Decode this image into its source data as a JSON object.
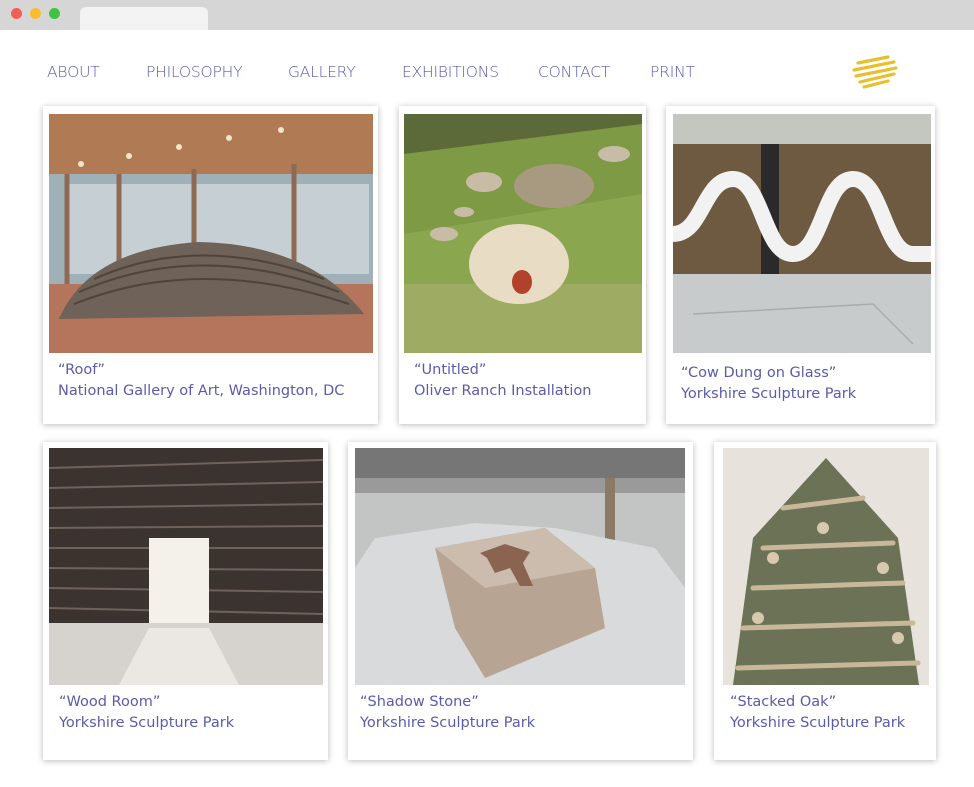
{
  "nav": {
    "items": [
      {
        "label": "ABOUT"
      },
      {
        "label": "PHILOSOPHY"
      },
      {
        "label": "GALLERY"
      },
      {
        "label": "EXHIBITIONS"
      },
      {
        "label": "CONTACT"
      },
      {
        "label": "PRINT"
      }
    ]
  },
  "colors": {
    "accent": "#5a5bab",
    "logo": "#e8c02c"
  },
  "gallery": {
    "cards": [
      {
        "title": "“Roof”",
        "location": "National Gallery of Art, Washington, DC"
      },
      {
        "title": "“Untitled”",
        "location": "Oliver Ranch Installation"
      },
      {
        "title": "“Cow Dung on Glass”",
        "location": "Yorkshire Sculpture Park"
      },
      {
        "title": "“Wood Room”",
        "location": "Yorkshire Sculpture Park"
      },
      {
        "title": "“Shadow Stone”",
        "location": "Yorkshire Sculpture Park"
      },
      {
        "title": "“Stacked Oak”",
        "location": "Yorkshire Sculpture Park"
      }
    ]
  }
}
